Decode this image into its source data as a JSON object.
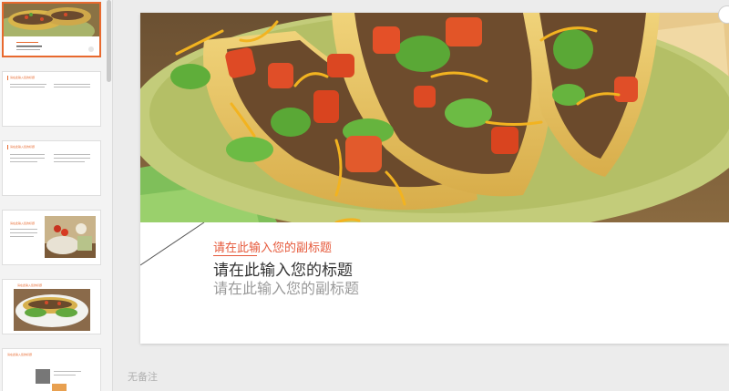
{
  "slide": {
    "subtitle_top": "请在此输入您的副标题",
    "title": "请在此输入您的标题",
    "subtitle_bottom": "请在此输入您的副标题"
  },
  "notes_placeholder": "无备注",
  "thumbnails": [
    {
      "kind": "cover",
      "text": "请在此输入您的标题"
    },
    {
      "kind": "text",
      "heading": "请在此输入您的标题"
    },
    {
      "kind": "text2",
      "heading": "请在此输入您的标题"
    },
    {
      "kind": "image-text",
      "heading": "请在此输入您的标题"
    },
    {
      "kind": "image",
      "heading": "请在此输入您的标题"
    },
    {
      "kind": "chart",
      "heading": "请在此输入您的标题"
    }
  ],
  "colors": {
    "accent": "#e8692e",
    "subtitle": "#e65a3c",
    "title": "#333333",
    "subtitle_gray": "#9a9a9a"
  }
}
